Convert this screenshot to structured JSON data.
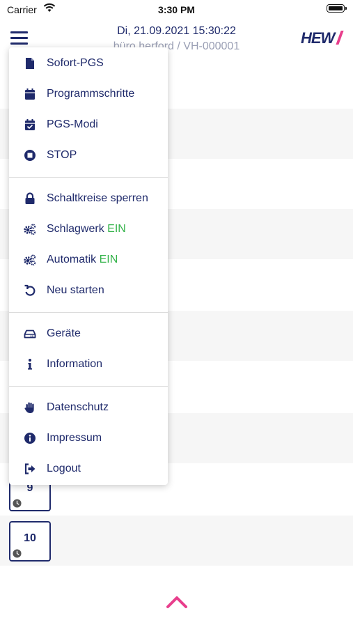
{
  "status_bar": {
    "carrier": "Carrier",
    "time": "3:30 PM"
  },
  "header": {
    "date_time": "Di, 21.09.2021 15:30:22",
    "subtitle": "büro herford / VH-000001",
    "logo_text": "HEW"
  },
  "tiles": [
    {
      "number": "9"
    },
    {
      "number": "10"
    }
  ],
  "menu": {
    "groups": [
      [
        {
          "label": "Sofort-PGS",
          "icon": "document-icon"
        },
        {
          "label": "Programmschritte",
          "icon": "calendar-icon"
        },
        {
          "label": "PGS-Modi",
          "icon": "calendar-check-icon"
        },
        {
          "label": "STOP",
          "icon": "stop-icon"
        }
      ],
      [
        {
          "label": "Schaltkreise sperren",
          "icon": "lock-icon"
        },
        {
          "label": "Schlagwerk",
          "status": "EIN",
          "icon": "gears-icon"
        },
        {
          "label": "Automatik",
          "status": "EIN",
          "icon": "gears-icon"
        },
        {
          "label": "Neu starten",
          "icon": "restart-icon"
        }
      ],
      [
        {
          "label": "Geräte",
          "icon": "device-icon"
        },
        {
          "label": "Information",
          "icon": "info-icon"
        }
      ],
      [
        {
          "label": "Datenschutz",
          "icon": "hand-icon"
        },
        {
          "label": "Impressum",
          "icon": "info-circle-icon"
        },
        {
          "label": "Logout",
          "icon": "logout-icon"
        }
      ]
    ]
  },
  "colors": {
    "primary": "#1f2a6b",
    "status_on": "#34b34a",
    "accent": "#e83e8c",
    "subtitle": "#9a9fb4"
  }
}
